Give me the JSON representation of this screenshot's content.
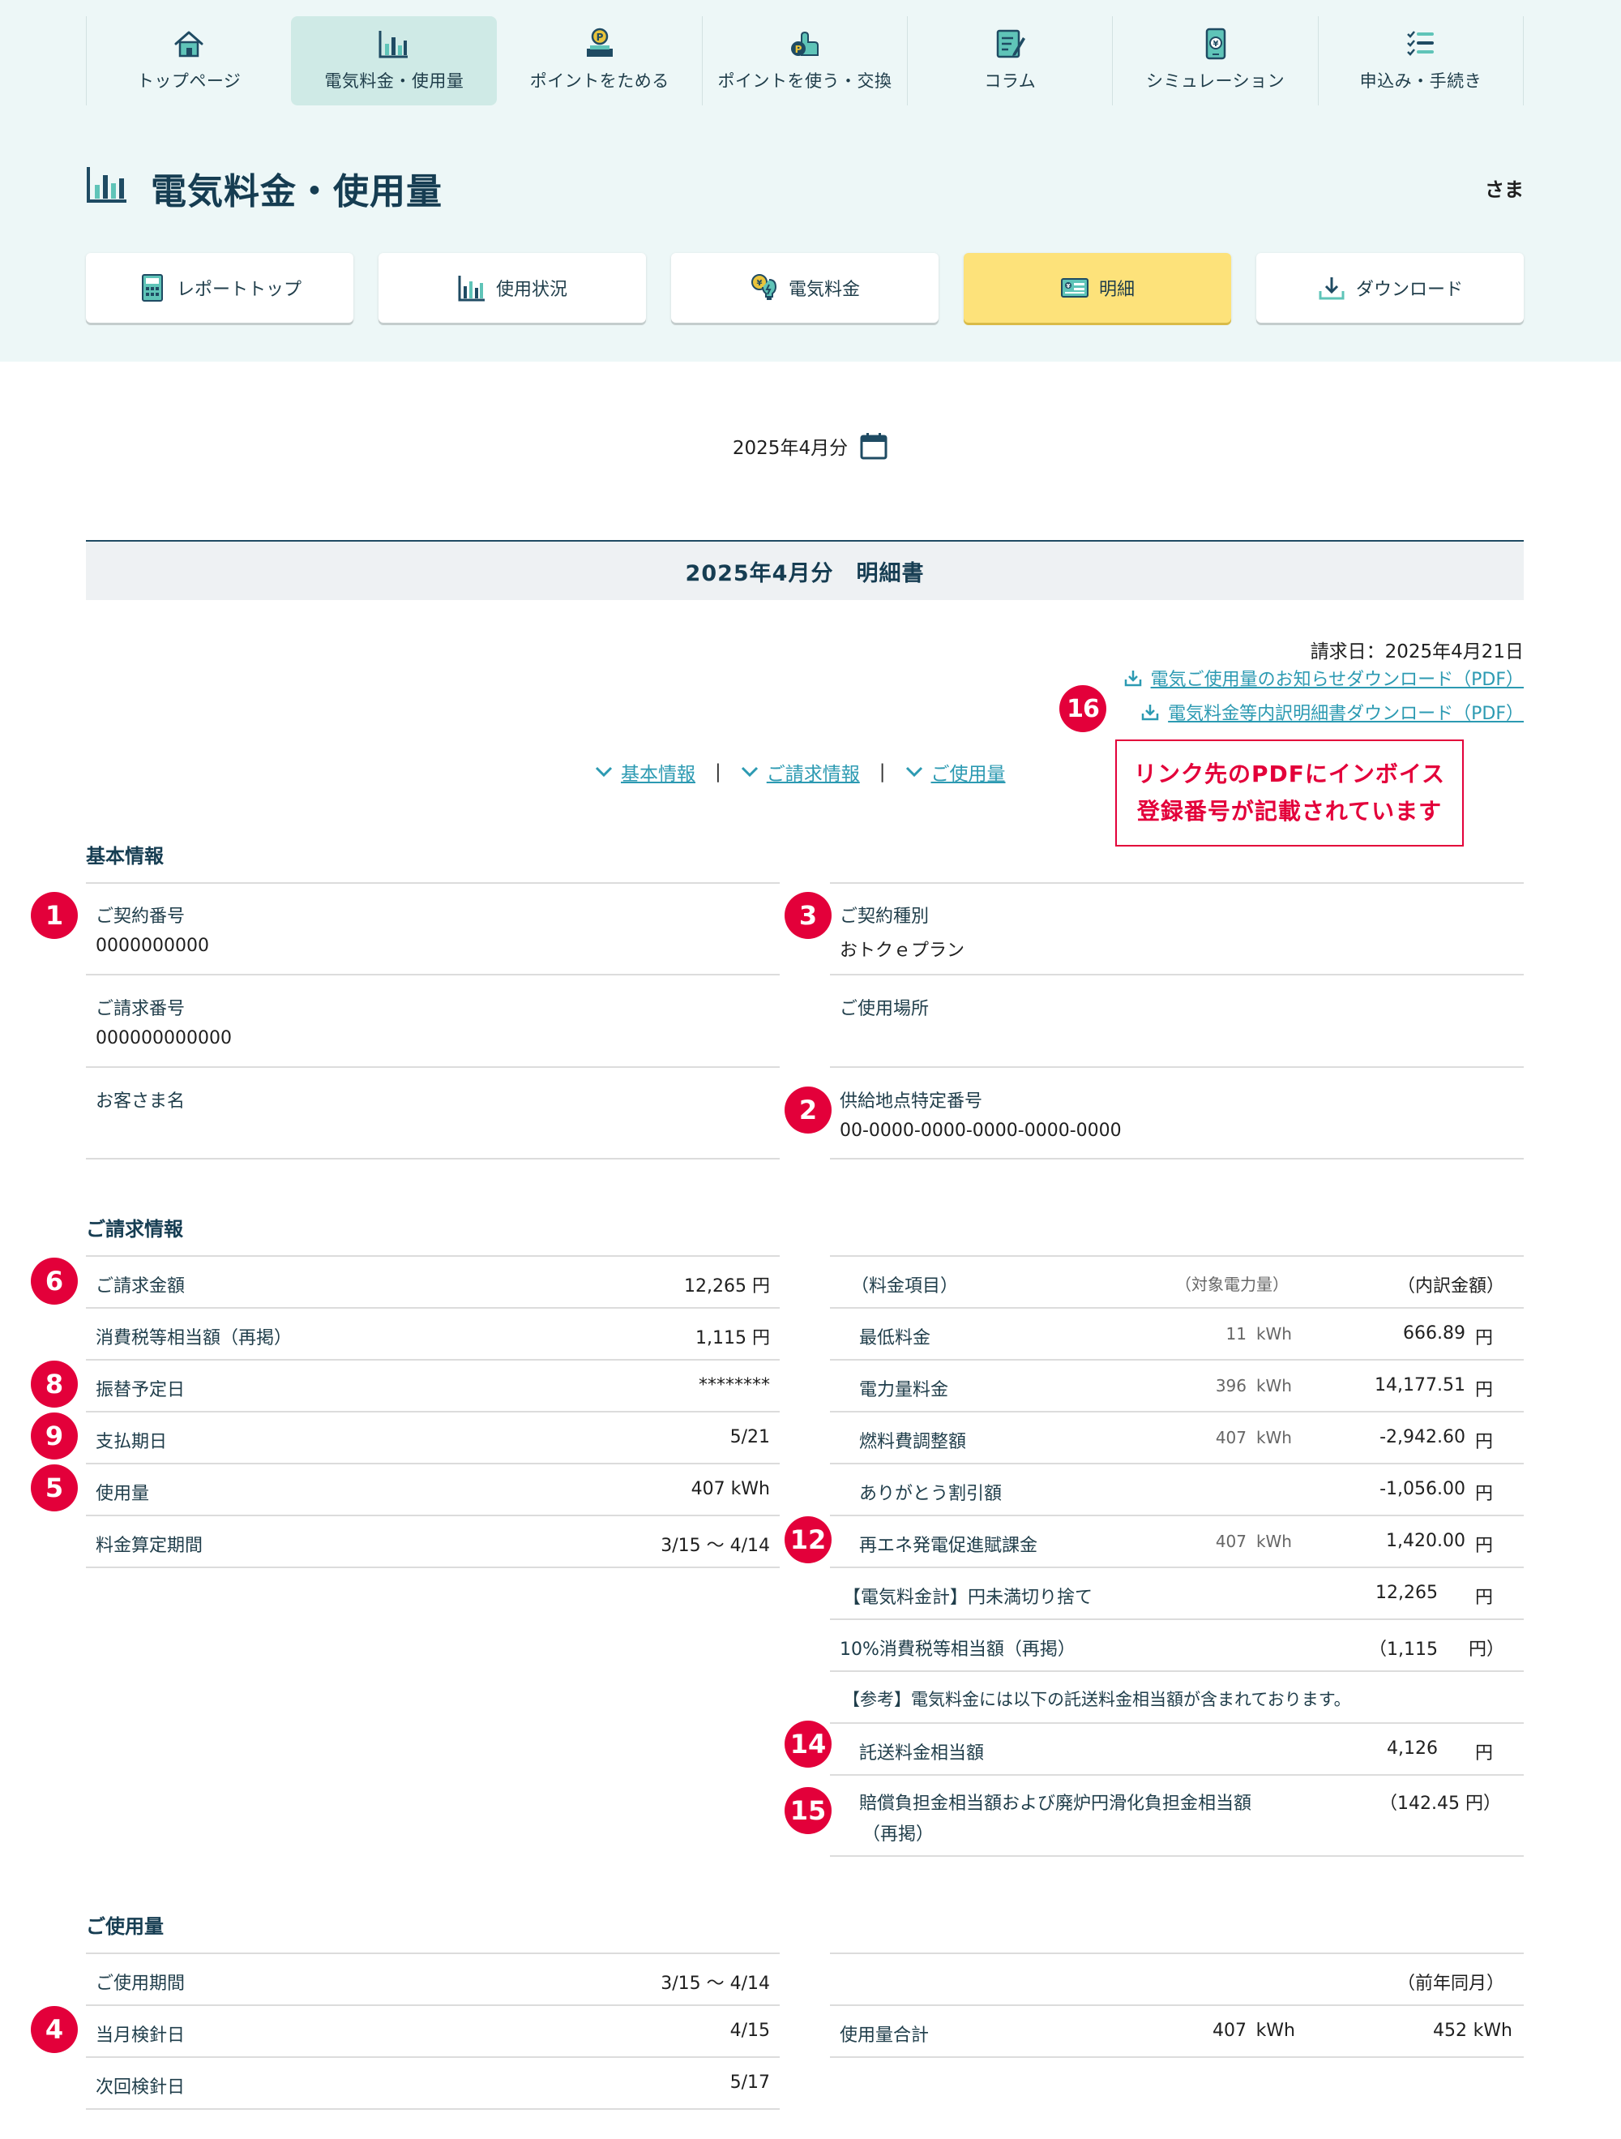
{
  "global_nav": [
    {
      "label": "トップページ",
      "icon": "home-icon"
    },
    {
      "label": "電気料金・使用量",
      "icon": "bar-chart-icon",
      "active": true
    },
    {
      "label": "ポイントをためる",
      "icon": "point-save-icon"
    },
    {
      "label": "ポイントを使う・交換",
      "icon": "point-use-icon"
    },
    {
      "label": "コラム",
      "icon": "column-icon"
    },
    {
      "label": "シミュレーション",
      "icon": "simulation-icon"
    },
    {
      "label": "申込み・手続き",
      "icon": "checklist-icon"
    }
  ],
  "page": {
    "title": "電気料金・使用量",
    "user_suffix": "さま"
  },
  "sub_tabs": [
    {
      "label": "レポートトップ",
      "icon": "calculator-icon"
    },
    {
      "label": "使用状況",
      "icon": "usage-chart-icon"
    },
    {
      "label": "電気料金",
      "icon": "yen-bulb-icon"
    },
    {
      "label": "明細",
      "icon": "statement-icon",
      "active": true
    },
    {
      "label": "ダウンロード",
      "icon": "download-icon"
    }
  ],
  "month": {
    "label": "2025年4月分"
  },
  "statement": {
    "title": "2025年4月分　明細書",
    "invoice_date": "請求日：2025年4月21日",
    "pdf_links": [
      "電気ご使用量のお知らせダウンロード（PDF）",
      "電気料金等内訳明細書ダウンロード（PDF）"
    ],
    "callout": [
      "リンク先のPDFにインボイス",
      "登録番号が記載されています"
    ]
  },
  "anchor_nav": [
    "基本情報",
    "ご請求情報",
    "ご使用量"
  ],
  "anchor_sep": "|",
  "badges": {
    "b1": "1",
    "b2": "2",
    "b3": "3",
    "b4": "4",
    "b5": "5",
    "b6": "6",
    "b8": "8",
    "b9": "9",
    "b12": "12",
    "b14": "14",
    "b15": "15",
    "b16": "16"
  },
  "basic_info": {
    "title": "基本情報",
    "contract_no": {
      "label": "ご契約番号",
      "value": "0000000000"
    },
    "invoice_no": {
      "label": "ご請求番号",
      "value": "000000000000"
    },
    "customer_name": {
      "label": "お客さま名",
      "value": ""
    },
    "contract_type": {
      "label": "ご契約種別",
      "value": "おトクｅプラン"
    },
    "usage_place": {
      "label": "ご使用場所",
      "value": ""
    },
    "supply_point": {
      "label": "供給地点特定番号",
      "value": "00-0000-0000-0000-0000-0000"
    }
  },
  "billing": {
    "title": "ご請求情報",
    "left_rows": [
      {
        "label": "ご請求金額",
        "value": "12,265 円"
      },
      {
        "label": "消費税等相当額（再掲）",
        "value": "1,115 円"
      },
      {
        "label": "振替予定日",
        "value": "********"
      },
      {
        "label": "支払期日",
        "value": "5/21"
      },
      {
        "label": "使用量",
        "value": "407 kWh"
      },
      {
        "label": "料金算定期間",
        "value": "3/15 〜 4/14"
      }
    ],
    "right_header": {
      "item": "（料金項目）",
      "kwh": "（対象電力量）",
      "amount": "（内訳金額）"
    },
    "right_rows": [
      {
        "label": "最低料金",
        "kwh": "11",
        "unit": "kWh",
        "amount": "666.89",
        "yen": "円"
      },
      {
        "label": "電力量料金",
        "kwh": "396",
        "unit": "kWh",
        "amount": "14,177.51",
        "yen": "円"
      },
      {
        "label": "燃料費調整額",
        "kwh": "407",
        "unit": "kWh",
        "amount": "-2,942.60",
        "yen": "円"
      },
      {
        "label": "ありがとう割引額",
        "kwh": "",
        "unit": "",
        "amount": "-1,056.00",
        "yen": "円"
      },
      {
        "label": "再エネ発電促進賦課金",
        "kwh": "407",
        "unit": "kWh",
        "amount": "1,420.00",
        "yen": "円"
      }
    ],
    "total": {
      "label": "【電気料金計】円未満切り捨て",
      "amount": "12,265",
      "yen": "円"
    },
    "tax": {
      "label": "10%消費税等相当額（再掲）",
      "amount": "（1,115",
      "yen": "円）"
    },
    "note": "【参考】電気料金には以下の託送料金相当額が含まれております。",
    "consignment": {
      "label": "託送料金相当額",
      "amount": "4,126",
      "yen": "円"
    },
    "compensation": {
      "label_1": "賠償負担金相当額および廃炉円滑化負担金相当額",
      "label_2": "（再掲）",
      "amount": "（142.45 円）"
    }
  },
  "usage": {
    "title": "ご使用量",
    "left_rows": [
      {
        "label": "ご使用期間",
        "value": "3/15 〜 4/14"
      },
      {
        "label": "当月検針日",
        "value": "4/15"
      },
      {
        "label": "次回検針日",
        "value": "5/17"
      }
    ],
    "right_header": "（前年同月）",
    "total": {
      "label": "使用量合計",
      "current": "407",
      "current_unit": "kWh",
      "prev": "452",
      "prev_unit": "kWh"
    }
  },
  "colors": {
    "accent_teal": "#2c9ab2",
    "navy": "#163d52",
    "badge_red": "#e3003a",
    "active_tab_yellow": "#fde27a",
    "header_bg": "#edf7f7"
  }
}
